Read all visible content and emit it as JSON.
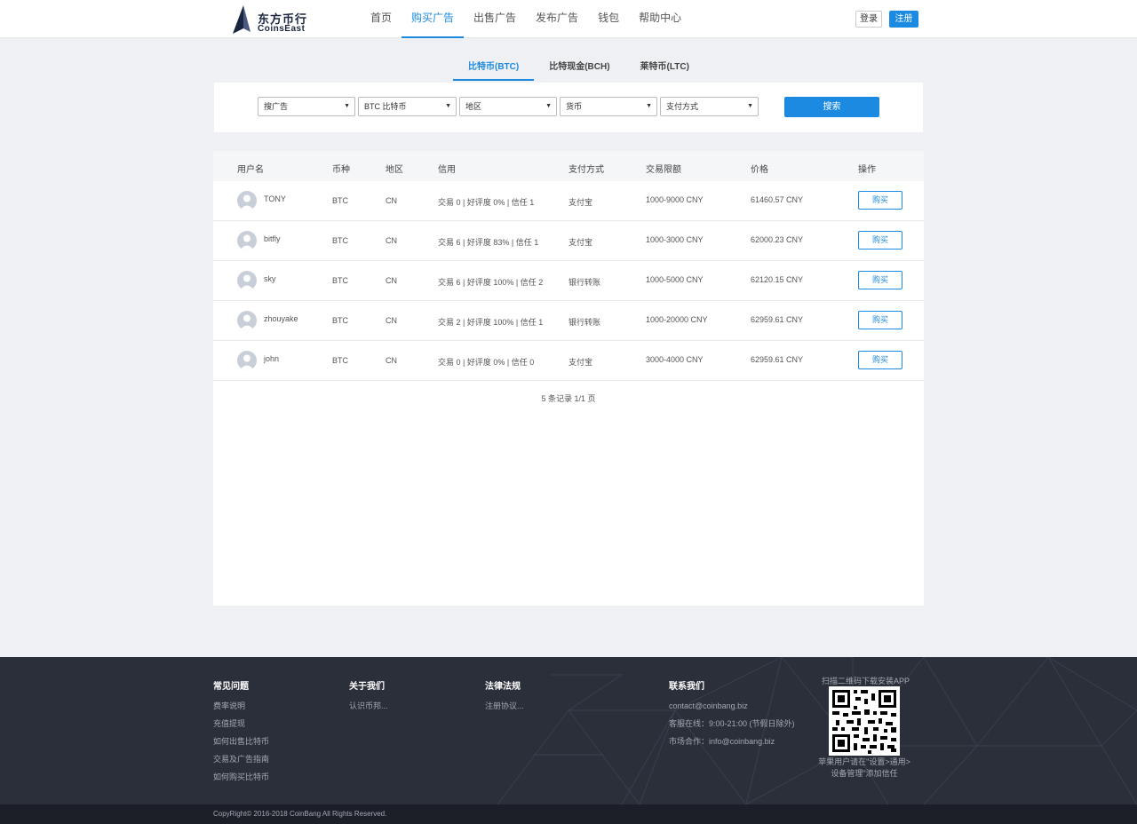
{
  "header": {
    "logo_cn": "东方币行",
    "logo_en": "CoinsEast",
    "nav": [
      {
        "label": "首页",
        "active": false
      },
      {
        "label": "购买广告",
        "active": true
      },
      {
        "label": "出售广告",
        "active": false
      },
      {
        "label": "发布广告",
        "active": false
      },
      {
        "label": "钱包",
        "active": false
      },
      {
        "label": "帮助中心",
        "active": false
      }
    ],
    "login_label": "登录",
    "register_label": "注册"
  },
  "coin_tabs": [
    {
      "label": "比特币(BTC)",
      "active": true
    },
    {
      "label": "比特现金(BCH)",
      "active": false
    },
    {
      "label": "莱特币(LTC)",
      "active": false
    }
  ],
  "filters": {
    "ad_type": "搜广告",
    "coin": "BTC 比特币",
    "region": "地区",
    "currency": "货币",
    "payment": "支付方式",
    "search_label": "搜索"
  },
  "table": {
    "headers": [
      "用户名",
      "币种",
      "地区",
      "信用",
      "支付方式",
      "交易限额",
      "价格",
      "操作"
    ],
    "rows": [
      {
        "user": "TONY",
        "coin": "BTC",
        "region": "CN",
        "credit": "交易 0 | 好评度 0% | 信任 1",
        "payment": "支付宝",
        "limit": "1000-9000 CNY",
        "price": "61460.57 CNY",
        "action": "购买"
      },
      {
        "user": "bitfly",
        "coin": "BTC",
        "region": "CN",
        "credit": "交易 6 | 好评度 83% | 信任 1",
        "payment": "支付宝",
        "limit": "1000-3000 CNY",
        "price": "62000.23 CNY",
        "action": "购买"
      },
      {
        "user": "sky",
        "coin": "BTC",
        "region": "CN",
        "credit": "交易 6 | 好评度 100% | 信任 2",
        "payment": "银行转账",
        "limit": "1000-5000 CNY",
        "price": "62120.15 CNY",
        "action": "购买"
      },
      {
        "user": "zhouyake",
        "coin": "BTC",
        "region": "CN",
        "credit": "交易 2 | 好评度 100% | 信任 1",
        "payment": "银行转账",
        "limit": "1000-20000 CNY",
        "price": "62959.61 CNY",
        "action": "购买"
      },
      {
        "user": "john",
        "coin": "BTC",
        "region": "CN",
        "credit": "交易 0 | 好评度 0% | 信任 0",
        "payment": "支付宝",
        "limit": "3000-4000 CNY",
        "price": "62959.61 CNY",
        "action": "购买"
      }
    ],
    "pager": "5 条记录 1/1 页"
  },
  "footer": {
    "faq": {
      "title": "常见问题",
      "links": [
        "费率说明",
        "充值提现",
        "如何出售比特币",
        "交易及广告指南",
        "如何购买比特币"
      ]
    },
    "about": {
      "title": "关于我们",
      "links": [
        "认识币邦..."
      ]
    },
    "legal": {
      "title": "法律法规",
      "links": [
        "注册协议..."
      ]
    },
    "contact": {
      "title": "联系我们",
      "links": [
        "contact@coinbang.biz",
        "客服在线：9:00-21:00 (节假日除外)",
        "市场合作：info@coinbang.biz"
      ]
    },
    "qr_title": "扫描二维码下载安装APP",
    "qr_note_1": "苹果用户请在\"设置>通用>",
    "qr_note_2": "设备管理\"添加信任",
    "copyright": "CopyRight© 2016-2018 CoinBang All Rights Reserved."
  },
  "colors": {
    "accent": "#1b8ae0",
    "footer_bg": "#2b2f3a"
  }
}
